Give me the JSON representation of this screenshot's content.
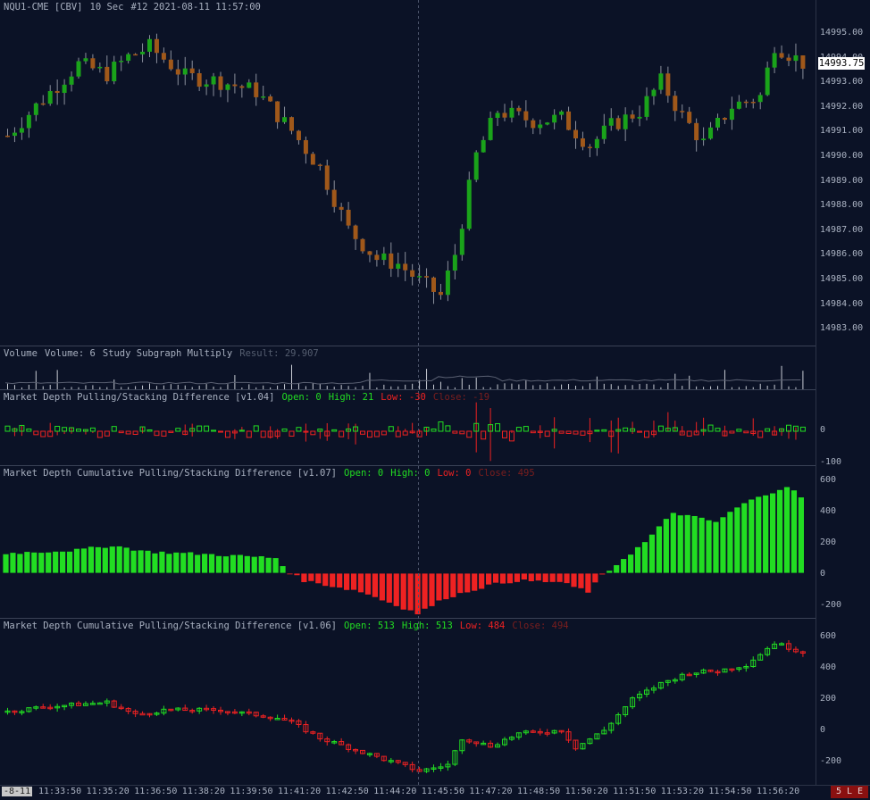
{
  "colors": {
    "up": "#1aa31a",
    "down": "#a0581a",
    "green": "#22dd22",
    "red": "#ee2222",
    "bg": "#0b1226"
  },
  "main": {
    "symbol": "NQU1-CME [CBV]",
    "interval": "10 Sec",
    "bar_info": "#12 2021-08-11 11:57:00",
    "current_price": "14993.75",
    "price_labels": [
      "14995.00",
      "14994.00",
      "14993.00",
      "14992.00",
      "14991.00",
      "14990.00",
      "14989.00",
      "14988.00",
      "14987.00",
      "14986.00",
      "14985.00",
      "14984.00",
      "14983.00"
    ]
  },
  "volume": {
    "label": "Volume",
    "value_label": "Volume: 6",
    "study": "Study Subgraph Multiply",
    "result": "Result: 29.907"
  },
  "pane1": {
    "title": "Market Depth Pulling/Stacking Difference [v1.04]",
    "open": "Open: 0",
    "high": "High: 21",
    "low": "Low: -30",
    "close": "Close: -19",
    "axis": [
      "0",
      "-100"
    ]
  },
  "pane2": {
    "title": "Market Depth Cumulative Pulling/Stacking Difference [v1.07]",
    "open": "Open: 0",
    "high": "High: 0",
    "low": "Low: 0",
    "close": "Close: 495",
    "axis": [
      "600",
      "400",
      "200",
      "0",
      "-200"
    ]
  },
  "pane3": {
    "title": "Market Depth Cumulative Pulling/Stacking Difference [v1.06]",
    "open": "Open: 513",
    "high": "High: 513",
    "low": "Low: 484",
    "close": "Close: 494",
    "axis": [
      "600",
      "400",
      "200",
      "0",
      "-200"
    ]
  },
  "time_labels": [
    "11:33:50",
    "11:35:20",
    "11:36:50",
    "11:38:20",
    "11:39:50",
    "11:41:20",
    "11:42:50",
    "11:44:20",
    "11:45:50",
    "11:47:20",
    "11:48:50",
    "11:50:20",
    "11:51:50",
    "11:53:20",
    "11:54:50",
    "11:56:20"
  ],
  "scroll_label": "-8-11",
  "status_label": "5 L E"
}
